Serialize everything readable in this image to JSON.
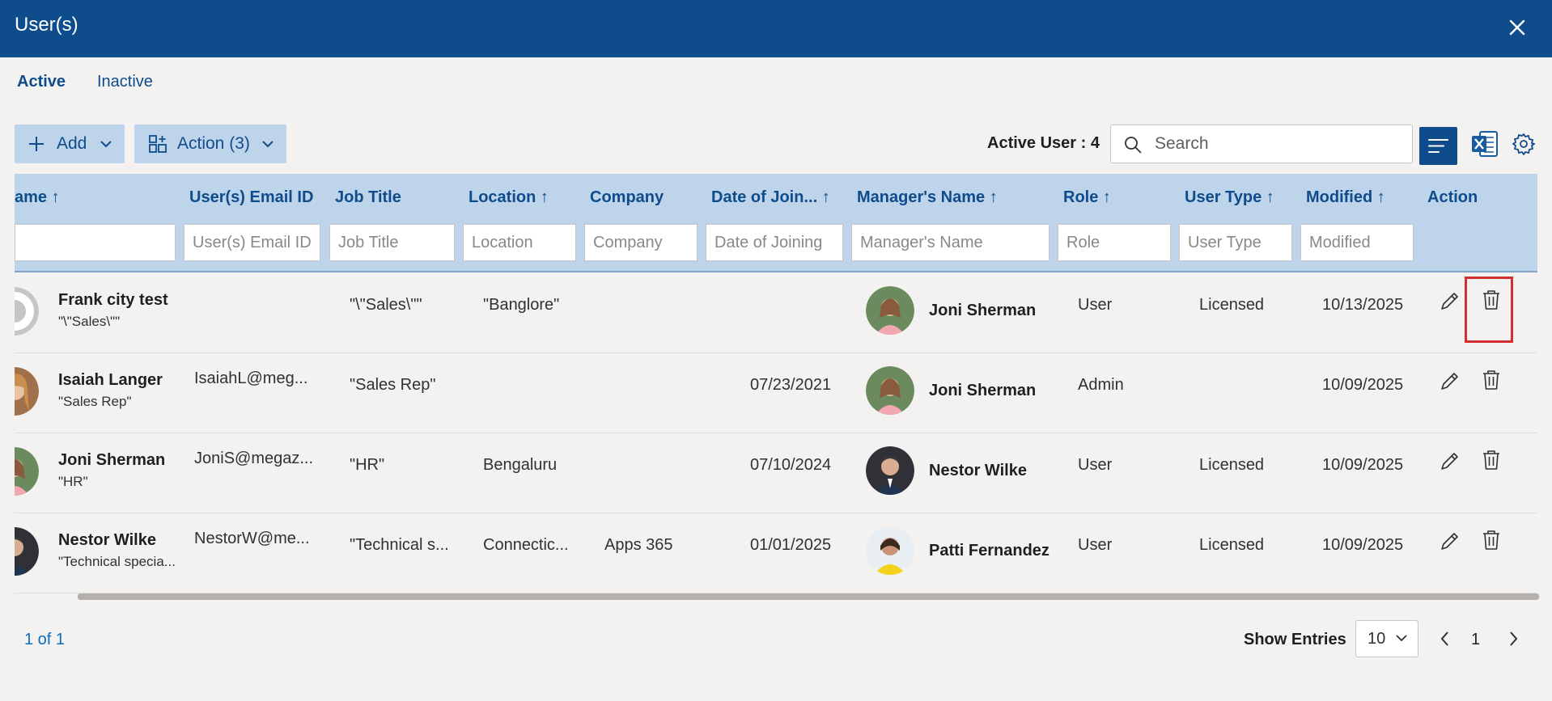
{
  "window": {
    "title": "User(s)"
  },
  "tabs": [
    {
      "label": "Active",
      "selected": true
    },
    {
      "label": "Inactive",
      "selected": false
    }
  ],
  "toolbar": {
    "add_label": "Add",
    "action_label": "Action (3)",
    "active_count": "Active User : 4",
    "search_placeholder": "Search"
  },
  "columns": [
    {
      "label": "ame",
      "sort": "↑",
      "filter_placeholder": ""
    },
    {
      "label": "User(s) Email ID",
      "sort": "",
      "filter_placeholder": "User(s) Email ID"
    },
    {
      "label": "Job Title",
      "sort": "",
      "filter_placeholder": "Job Title"
    },
    {
      "label": "Location",
      "sort": "↑",
      "filter_placeholder": "Location"
    },
    {
      "label": "Company",
      "sort": "",
      "filter_placeholder": "Company"
    },
    {
      "label": "Date of Join...",
      "sort": "↑",
      "filter_placeholder": "Date of Joining"
    },
    {
      "label": "Manager's Name",
      "sort": "↑",
      "filter_placeholder": "Manager's Name"
    },
    {
      "label": "Role",
      "sort": "↑",
      "filter_placeholder": "Role"
    },
    {
      "label": "User Type",
      "sort": "↑",
      "filter_placeholder": "User Type"
    },
    {
      "label": "Modified",
      "sort": "↑",
      "filter_placeholder": "Modified"
    },
    {
      "label": "Action",
      "sort": "",
      "filter_placeholder": ""
    }
  ],
  "rows": [
    {
      "name": "Frank city test",
      "subtitle": "\"\\\"Sales\\\"\"",
      "email": "",
      "job_title": "\"\\\"Sales\\\"\"",
      "location": "\"Banglore\"",
      "company": "",
      "date_of_joining": "",
      "manager": "Joni Sherman",
      "role": "User",
      "user_type": "Licensed",
      "modified": "10/13/2025",
      "avatar": "default-avatar",
      "manager_avatar": "joni-photo"
    },
    {
      "name": "Isaiah Langer",
      "subtitle": "\"Sales Rep\"",
      "email": "IsaiahL@meg...",
      "job_title": "\"Sales Rep\"",
      "location": "",
      "company": "",
      "date_of_joining": "07/23/2021",
      "manager": "Joni Sherman",
      "role": "Admin",
      "user_type": "",
      "modified": "10/09/2025",
      "avatar": "isaiah-photo",
      "manager_avatar": "joni-photo"
    },
    {
      "name": "Joni Sherman",
      "subtitle": "\"HR\"",
      "email": "JoniS@megaz...",
      "job_title": "\"HR\"",
      "location": "Bengaluru",
      "company": "",
      "date_of_joining": "07/10/2024",
      "manager": "Nestor Wilke",
      "role": "User",
      "user_type": "Licensed",
      "modified": "10/09/2025",
      "avatar": "joni-photo",
      "manager_avatar": "nestor-photo"
    },
    {
      "name": "Nestor Wilke",
      "subtitle": "\"Technical specia...",
      "email": "NestorW@me...",
      "job_title": "\"Technical s...",
      "location": "Connectic...",
      "company": "Apps 365",
      "date_of_joining": "01/01/2025",
      "manager": "Patti Fernandez",
      "role": "User",
      "user_type": "Licensed",
      "modified": "10/09/2025",
      "avatar": "nestor-photo",
      "manager_avatar": "patti-photo"
    }
  ],
  "footer": {
    "page_info": "1 of 1",
    "show_entries_label": "Show Entries",
    "entries_value": "10",
    "current_page": "1"
  },
  "colors": {
    "header": "#0f4c8c",
    "accent_bg": "#bed4ea",
    "highlight": "#d32f2f"
  }
}
